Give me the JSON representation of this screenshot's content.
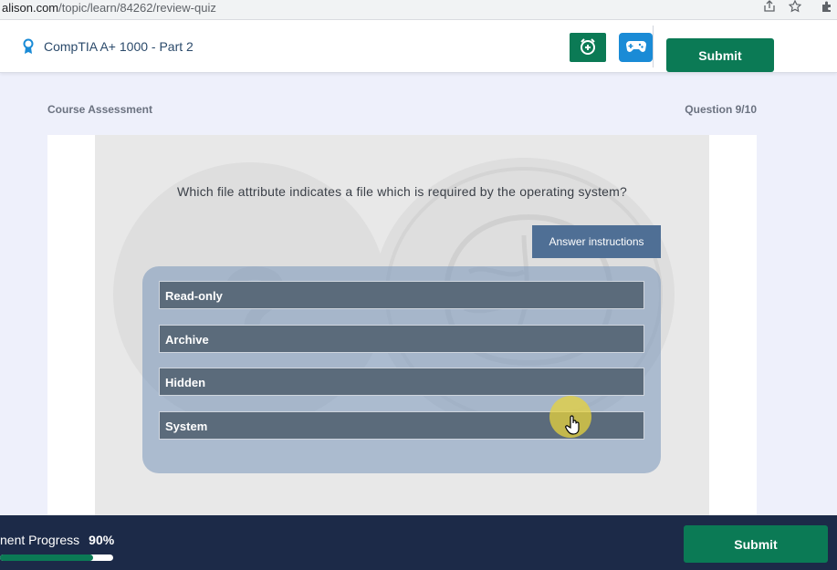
{
  "browser": {
    "url_domain": "alison.com",
    "url_path": "/topic/learn/84262/review-quiz"
  },
  "header": {
    "course_title": "CompTIA A+ 1000 - Part 2",
    "submit_label": "Submit"
  },
  "assessment": {
    "section_label": "Course Assessment",
    "question_counter": "Question 9/10",
    "question": "Which file attribute indicates a file which is required by the operating system?",
    "instructions_label": "Answer instructions",
    "answers": [
      {
        "label": "Read-only"
      },
      {
        "label": "Archive"
      },
      {
        "label": "Hidden"
      },
      {
        "label": "System"
      }
    ]
  },
  "footer": {
    "progress_label": "nent Progress",
    "progress_percent": "90%",
    "progress_value": 0.82,
    "submit_label": "Submit"
  },
  "colors": {
    "primary_green": "#0b7a55",
    "game_blue": "#1a8bd6",
    "footer_navy": "#1c2a48",
    "instructions_blue": "#4f6f95"
  },
  "icons": [
    "share-icon",
    "star-icon",
    "extensions-icon",
    "award-ribbon-icon",
    "add-alarm-icon",
    "gamepad-icon",
    "hand-cursor-icon"
  ]
}
